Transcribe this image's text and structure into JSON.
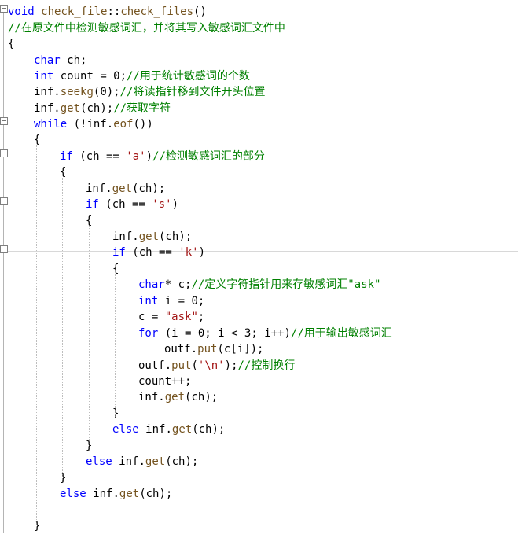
{
  "colors": {
    "keyword": "#0000ff",
    "string": "#a31515",
    "comment": "#008000",
    "function": "#74531f",
    "text": "#000000",
    "fold_box": "#7f7f7f",
    "indent_guide": "#bdbdbd"
  },
  "editor": {
    "lines": [
      {
        "fold": "minus",
        "tokens": [
          {
            "t": "kw",
            "s": "void"
          },
          {
            "t": "op",
            "s": " "
          },
          {
            "t": "fn",
            "s": "check_file"
          },
          {
            "t": "op",
            "s": "::"
          },
          {
            "t": "fn",
            "s": "check_files"
          },
          {
            "t": "op",
            "s": "()"
          }
        ]
      },
      {
        "tokens": [
          {
            "t": "cm",
            "s": "//在原文件中检测敏感词汇，并将其写入敏感词汇文件中"
          }
        ]
      },
      {
        "tokens": [
          {
            "t": "op",
            "s": "{"
          }
        ]
      },
      {
        "tokens": [
          {
            "t": "kw",
            "s": "char"
          },
          {
            "t": "op",
            "s": " "
          },
          {
            "t": "id",
            "s": "ch"
          },
          {
            "t": "op",
            "s": ";"
          }
        ]
      },
      {
        "tokens": [
          {
            "t": "kw",
            "s": "int"
          },
          {
            "t": "op",
            "s": " "
          },
          {
            "t": "id",
            "s": "count"
          },
          {
            "t": "op",
            "s": " = 0;"
          },
          {
            "t": "cm",
            "s": "//用于统计敏感词的个数"
          }
        ]
      },
      {
        "tokens": [
          {
            "t": "id",
            "s": "inf"
          },
          {
            "t": "op",
            "s": "."
          },
          {
            "t": "fn",
            "s": "seekg"
          },
          {
            "t": "op",
            "s": "(0);"
          },
          {
            "t": "cm",
            "s": "//将读指针移到文件开头位置"
          }
        ]
      },
      {
        "tokens": [
          {
            "t": "id",
            "s": "inf"
          },
          {
            "t": "op",
            "s": "."
          },
          {
            "t": "fn",
            "s": "get"
          },
          {
            "t": "op",
            "s": "("
          },
          {
            "t": "id",
            "s": "ch"
          },
          {
            "t": "op",
            "s": ");"
          },
          {
            "t": "cm",
            "s": "//获取字符"
          }
        ]
      },
      {
        "fold": "minus",
        "tokens": [
          {
            "t": "kw",
            "s": "while"
          },
          {
            "t": "op",
            "s": " (!"
          },
          {
            "t": "id",
            "s": "inf"
          },
          {
            "t": "op",
            "s": "."
          },
          {
            "t": "fn",
            "s": "eof"
          },
          {
            "t": "op",
            "s": "())"
          }
        ]
      },
      {
        "tokens": [
          {
            "t": "op",
            "s": "{"
          }
        ]
      },
      {
        "fold": "minus",
        "tokens": [
          {
            "t": "kw",
            "s": "if"
          },
          {
            "t": "op",
            "s": " ("
          },
          {
            "t": "id",
            "s": "ch"
          },
          {
            "t": "op",
            "s": " == "
          },
          {
            "t": "str",
            "s": "'a'"
          },
          {
            "t": "op",
            "s": ")"
          },
          {
            "t": "cm",
            "s": "//检测敏感词汇的部分"
          }
        ]
      },
      {
        "tokens": [
          {
            "t": "op",
            "s": "{"
          }
        ]
      },
      {
        "tokens": [
          {
            "t": "id",
            "s": "inf"
          },
          {
            "t": "op",
            "s": "."
          },
          {
            "t": "fn",
            "s": "get"
          },
          {
            "t": "op",
            "s": "("
          },
          {
            "t": "id",
            "s": "ch"
          },
          {
            "t": "op",
            "s": ");"
          }
        ]
      },
      {
        "fold": "minus",
        "tokens": [
          {
            "t": "kw",
            "s": "if"
          },
          {
            "t": "op",
            "s": " ("
          },
          {
            "t": "id",
            "s": "ch"
          },
          {
            "t": "op",
            "s": " == "
          },
          {
            "t": "str",
            "s": "'s'"
          },
          {
            "t": "op",
            "s": ")"
          }
        ]
      },
      {
        "tokens": [
          {
            "t": "op",
            "s": "{"
          }
        ]
      },
      {
        "tokens": [
          {
            "t": "id",
            "s": "inf"
          },
          {
            "t": "op",
            "s": "."
          },
          {
            "t": "fn",
            "s": "get"
          },
          {
            "t": "op",
            "s": "("
          },
          {
            "t": "id",
            "s": "ch"
          },
          {
            "t": "op",
            "s": ");"
          }
        ]
      },
      {
        "fold": "minus",
        "tokens": [
          {
            "t": "kw",
            "s": "if"
          },
          {
            "t": "op",
            "s": " ("
          },
          {
            "t": "id",
            "s": "ch"
          },
          {
            "t": "op",
            "s": " == "
          },
          {
            "t": "str",
            "s": "'k'"
          },
          {
            "t": "op",
            "s": ")"
          }
        ]
      },
      {
        "tokens": [
          {
            "t": "op",
            "s": "{"
          }
        ]
      },
      {
        "tokens": [
          {
            "t": "kw",
            "s": "char"
          },
          {
            "t": "op",
            "s": "* "
          },
          {
            "t": "id",
            "s": "c"
          },
          {
            "t": "op",
            "s": ";"
          },
          {
            "t": "cm",
            "s": "//定义字符指针用来存敏感词汇\"ask\""
          }
        ]
      },
      {
        "tokens": [
          {
            "t": "kw",
            "s": "int"
          },
          {
            "t": "op",
            "s": " "
          },
          {
            "t": "id",
            "s": "i"
          },
          {
            "t": "op",
            "s": " = 0;"
          }
        ]
      },
      {
        "tokens": [
          {
            "t": "id",
            "s": "c"
          },
          {
            "t": "op",
            "s": " = "
          },
          {
            "t": "str",
            "s": "\"ask\""
          },
          {
            "t": "op",
            "s": ";"
          }
        ]
      },
      {
        "tokens": [
          {
            "t": "kw",
            "s": "for"
          },
          {
            "t": "op",
            "s": " ("
          },
          {
            "t": "id",
            "s": "i"
          },
          {
            "t": "op",
            "s": " = 0; "
          },
          {
            "t": "id",
            "s": "i"
          },
          {
            "t": "op",
            "s": " < 3; "
          },
          {
            "t": "id",
            "s": "i"
          },
          {
            "t": "op",
            "s": "++)"
          },
          {
            "t": "cm",
            "s": "//用于输出敏感词汇"
          }
        ]
      },
      {
        "tokens": [
          {
            "t": "id",
            "s": "outf"
          },
          {
            "t": "op",
            "s": "."
          },
          {
            "t": "fn",
            "s": "put"
          },
          {
            "t": "op",
            "s": "("
          },
          {
            "t": "id",
            "s": "c"
          },
          {
            "t": "op",
            "s": "["
          },
          {
            "t": "id",
            "s": "i"
          },
          {
            "t": "op",
            "s": "]);"
          }
        ]
      },
      {
        "tokens": [
          {
            "t": "id",
            "s": "outf"
          },
          {
            "t": "op",
            "s": "."
          },
          {
            "t": "fn",
            "s": "put"
          },
          {
            "t": "op",
            "s": "("
          },
          {
            "t": "str",
            "s": "'\\n'"
          },
          {
            "t": "op",
            "s": ");"
          },
          {
            "t": "cm",
            "s": "//控制换行"
          }
        ]
      },
      {
        "tokens": [
          {
            "t": "id",
            "s": "count"
          },
          {
            "t": "op",
            "s": "++;"
          }
        ]
      },
      {
        "tokens": [
          {
            "t": "id",
            "s": "inf"
          },
          {
            "t": "op",
            "s": "."
          },
          {
            "t": "fn",
            "s": "get"
          },
          {
            "t": "op",
            "s": "("
          },
          {
            "t": "id",
            "s": "ch"
          },
          {
            "t": "op",
            "s": ");"
          }
        ]
      },
      {
        "tokens": [
          {
            "t": "op",
            "s": "}"
          }
        ]
      },
      {
        "tokens": [
          {
            "t": "kw",
            "s": "else"
          },
          {
            "t": "op",
            "s": " "
          },
          {
            "t": "id",
            "s": "inf"
          },
          {
            "t": "op",
            "s": "."
          },
          {
            "t": "fn",
            "s": "get"
          },
          {
            "t": "op",
            "s": "("
          },
          {
            "t": "id",
            "s": "ch"
          },
          {
            "t": "op",
            "s": ");"
          }
        ]
      },
      {
        "tokens": [
          {
            "t": "op",
            "s": "}"
          }
        ]
      },
      {
        "tokens": [
          {
            "t": "kw",
            "s": "else"
          },
          {
            "t": "op",
            "s": " "
          },
          {
            "t": "id",
            "s": "inf"
          },
          {
            "t": "op",
            "s": "."
          },
          {
            "t": "fn",
            "s": "get"
          },
          {
            "t": "op",
            "s": "("
          },
          {
            "t": "id",
            "s": "ch"
          },
          {
            "t": "op",
            "s": ");"
          }
        ]
      },
      {
        "tokens": [
          {
            "t": "op",
            "s": "}"
          }
        ]
      },
      {
        "tokens": [
          {
            "t": "kw",
            "s": "else"
          },
          {
            "t": "op",
            "s": " "
          },
          {
            "t": "id",
            "s": "inf"
          },
          {
            "t": "op",
            "s": "."
          },
          {
            "t": "fn",
            "s": "get"
          },
          {
            "t": "op",
            "s": "("
          },
          {
            "t": "id",
            "s": "ch"
          },
          {
            "t": "op",
            "s": ");"
          }
        ]
      },
      {
        "tokens": []
      },
      {
        "tokens": [
          {
            "t": "op",
            "s": "}"
          }
        ]
      }
    ]
  }
}
